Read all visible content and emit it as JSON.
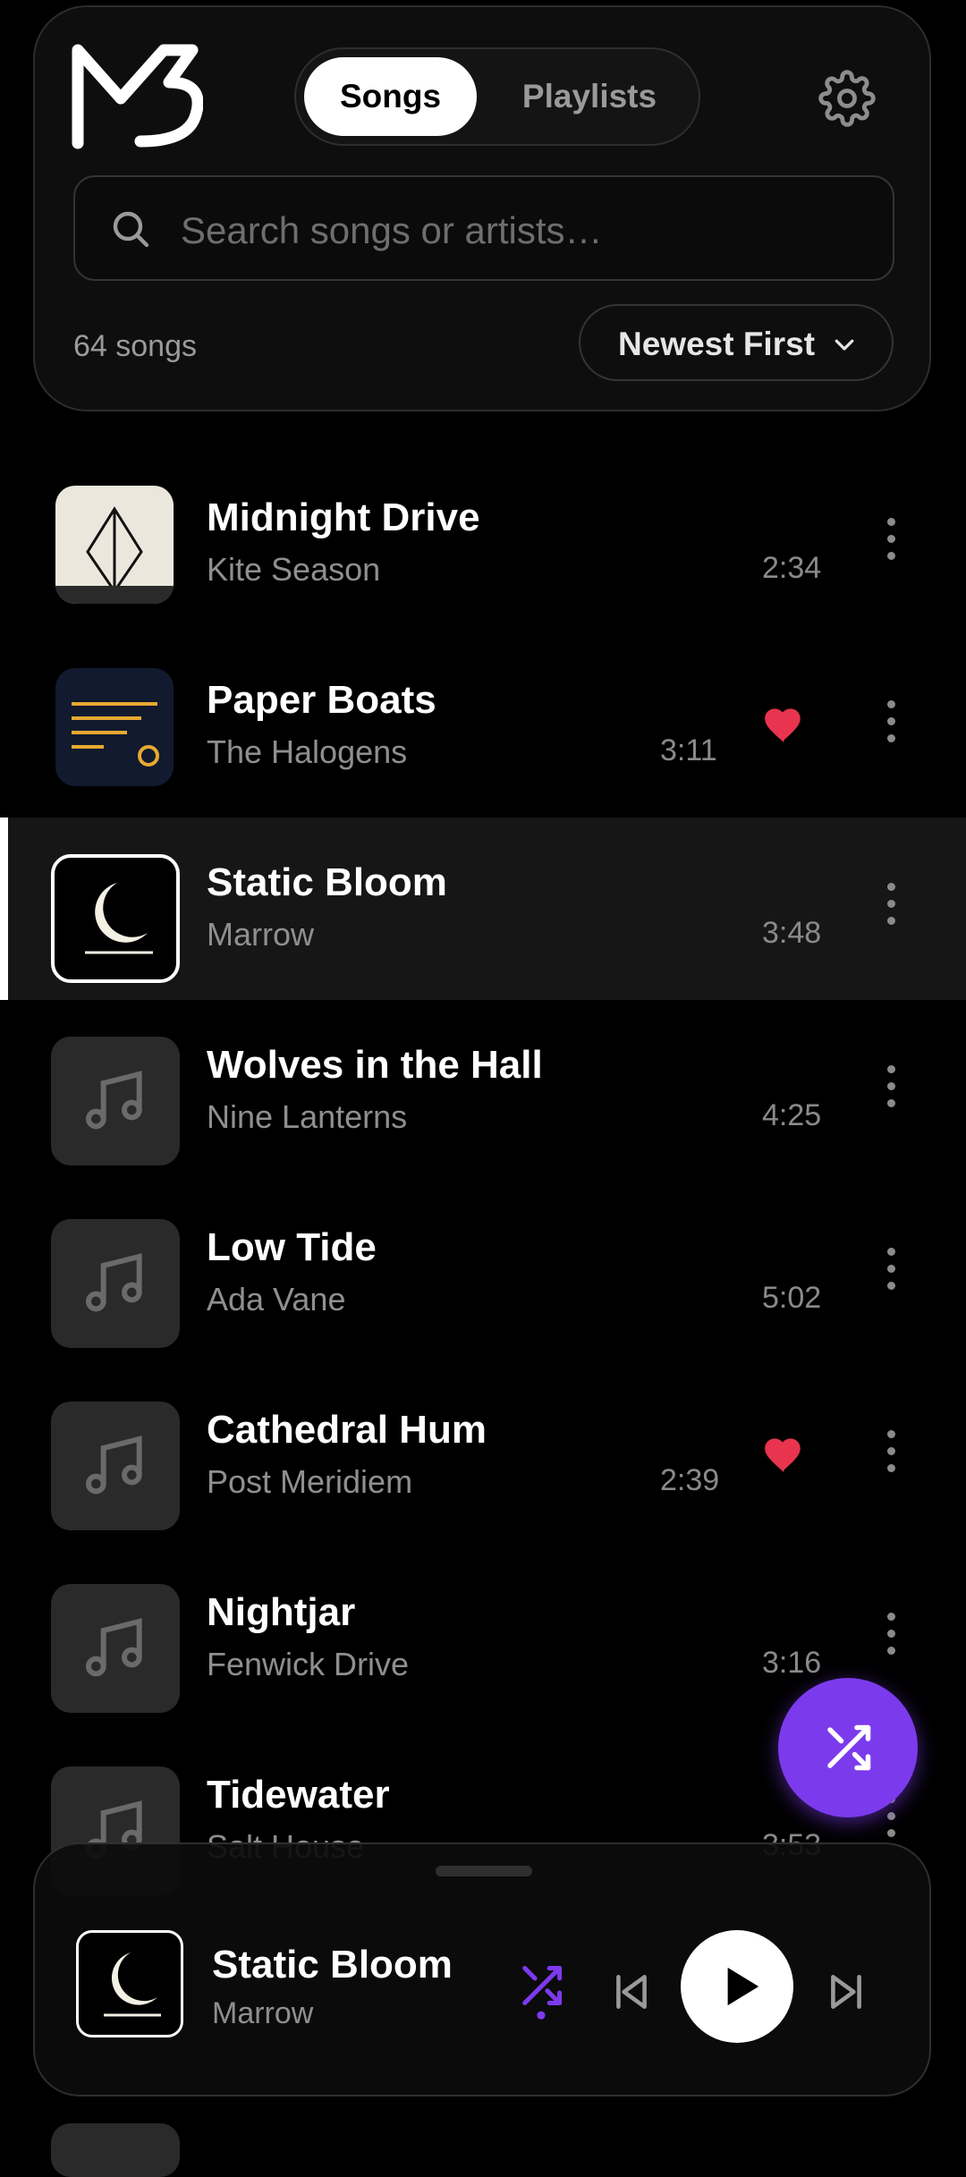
{
  "header": {
    "tabs": [
      {
        "label": "Songs",
        "active": true
      },
      {
        "label": "Playlists",
        "active": false
      }
    ],
    "search_placeholder": "Search songs or artists…",
    "song_count": "64 songs",
    "sort_label": "Newest First"
  },
  "songs": [
    {
      "title": "Midnight Drive",
      "artist": "Kite Season",
      "duration": "2:34",
      "liked": false,
      "art": "diamond-art"
    },
    {
      "title": "Paper Boats",
      "artist": "The Halogens",
      "duration": "3:11",
      "liked": true,
      "art": "lines-art"
    },
    {
      "title": "Static Bloom",
      "artist": "Marrow",
      "duration": "3:48",
      "liked": false,
      "art": "moon-art",
      "current": true
    },
    {
      "title": "Wolves in the Hall",
      "artist": "Nine Lanterns",
      "duration": "4:25",
      "liked": false,
      "art": "music-note-icon"
    },
    {
      "title": "Low Tide",
      "artist": "Ada Vane",
      "duration": "5:02",
      "liked": false,
      "art": "music-note-icon"
    },
    {
      "title": "Cathedral Hum",
      "artist": "Post Meridiem",
      "duration": "2:39",
      "liked": true,
      "art": "music-note-icon"
    },
    {
      "title": "Nightjar",
      "artist": "Fenwick Drive",
      "duration": "3:16",
      "liked": false,
      "art": "music-note-icon"
    },
    {
      "title": "Tidewater",
      "artist": "Salt House",
      "duration": "3:53",
      "liked": false,
      "art": "music-note-icon"
    }
  ],
  "player": {
    "title": "Static Bloom",
    "artist": "Marrow",
    "shuffle_on": true
  },
  "colors": {
    "accent": "#7c3aed",
    "heart": "#e8344e",
    "background": "#000000"
  }
}
